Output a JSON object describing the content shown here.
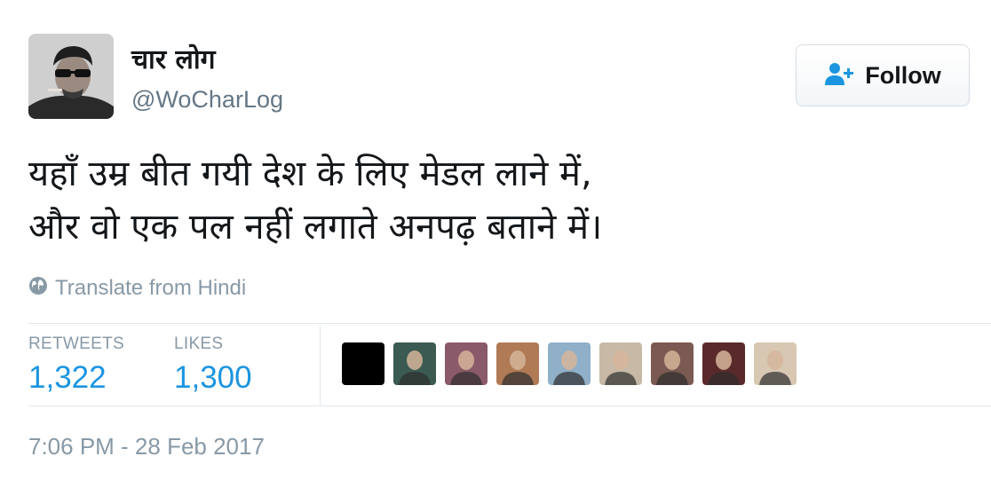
{
  "user": {
    "display_name": "चार लोग",
    "handle": "@WoCharLog"
  },
  "follow_button": {
    "label": "Follow",
    "icon": "add-person-icon",
    "accent": "#1b95e0"
  },
  "tweet": {
    "lines": [
      "यहाँ उम्र बीत गयी देश के लिए मेडल लाने में,",
      "और वो एक पल नहीं लगाते अनपढ़ बताने में।"
    ]
  },
  "translate": {
    "label": "Translate from Hindi",
    "icon": "globe-icon"
  },
  "stats": {
    "retweets_label": "RETWEETS",
    "retweets_value": "1,322",
    "likes_label": "LIKES",
    "likes_value": "1,300"
  },
  "liker_avatars": [
    {
      "icon": "user-avatar",
      "color": "#000000"
    },
    {
      "icon": "user-avatar",
      "color": "#3a5a52"
    },
    {
      "icon": "user-avatar",
      "color": "#8a5a6a"
    },
    {
      "icon": "user-avatar",
      "color": "#b07a55"
    },
    {
      "icon": "user-avatar",
      "color": "#8fb0c8"
    },
    {
      "icon": "user-avatar",
      "color": "#c7b9a6"
    },
    {
      "icon": "user-avatar",
      "color": "#7a5a52"
    },
    {
      "icon": "user-avatar",
      "color": "#5a2a2a"
    },
    {
      "icon": "user-avatar",
      "color": "#d8c7b3"
    }
  ],
  "timestamp": "7:06 PM - 28 Feb 2017",
  "colors": {
    "link_blue": "#1b95e0",
    "muted_gray": "#8899a6",
    "handle_gray": "#657786",
    "divider": "#e1e8ed"
  }
}
